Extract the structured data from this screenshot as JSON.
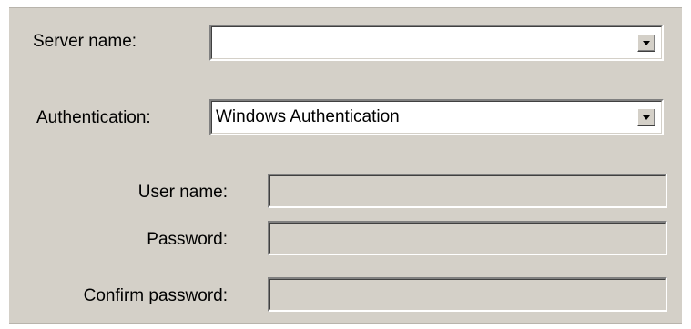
{
  "form": {
    "server_name": {
      "label": "Server name:",
      "value": ""
    },
    "authentication": {
      "label": "Authentication:",
      "value": "Windows Authentication"
    },
    "user_name": {
      "label": "User name:",
      "value": ""
    },
    "password": {
      "label": "Password:",
      "value": ""
    },
    "confirm_password": {
      "label": "Confirm password:",
      "value": ""
    }
  },
  "icons": {
    "dropdown": "chevron-down-icon"
  },
  "colors": {
    "dialog_background": "#d4d0c8",
    "field_background": "#ffffff",
    "disabled_field_background": "#d4d0c8"
  }
}
